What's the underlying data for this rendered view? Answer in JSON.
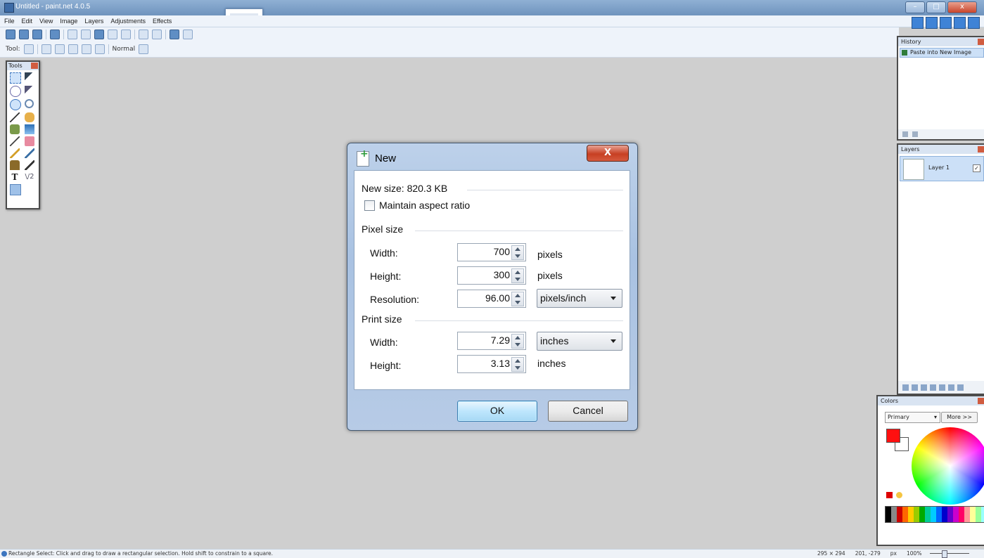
{
  "window": {
    "title": "Untitled - paint.net 4.0.5"
  },
  "menu": [
    "File",
    "Edit",
    "View",
    "Image",
    "Layers",
    "Adjustments",
    "Effects"
  ],
  "toolbar": {
    "tool_label": "Tool:",
    "blend_mode": "Normal"
  },
  "tools_panel": {
    "title": "Tools"
  },
  "history_panel": {
    "title": "History",
    "items": [
      "Paste into New Image"
    ]
  },
  "layers_panel": {
    "title": "Layers",
    "layers": [
      {
        "name": "Layer 1",
        "visible": true
      }
    ]
  },
  "colors_panel": {
    "title": "Colors",
    "mode": "Primary",
    "more_label": "More >>",
    "primary_color": "#ff1010",
    "secondary_color": "#ffffff"
  },
  "dialog": {
    "title": "New",
    "close_label": "X",
    "new_size": "New size: 820.3 KB",
    "maintain_aspect": "Maintain aspect ratio",
    "maintain_aspect_checked": false,
    "pixel_size": {
      "heading": "Pixel size",
      "width_label": "Width:",
      "width_value": "700",
      "width_unit": "pixels",
      "height_label": "Height:",
      "height_value": "300",
      "height_unit": "pixels",
      "resolution_label": "Resolution:",
      "resolution_value": "96.00",
      "resolution_unit": "pixels/inch"
    },
    "print_size": {
      "heading": "Print size",
      "width_label": "Width:",
      "width_value": "7.29",
      "width_unit": "inches",
      "height_label": "Height:",
      "height_value": "3.13",
      "height_unit": "inches"
    },
    "ok_label": "OK",
    "cancel_label": "Cancel"
  },
  "status": {
    "text": "Rectangle Select: Click and drag to draw a rectangular selection. Hold shift to constrain to a square.",
    "image_size": "295 × 294",
    "cursor": "201, -279",
    "units": "px",
    "zoom": "100%"
  }
}
